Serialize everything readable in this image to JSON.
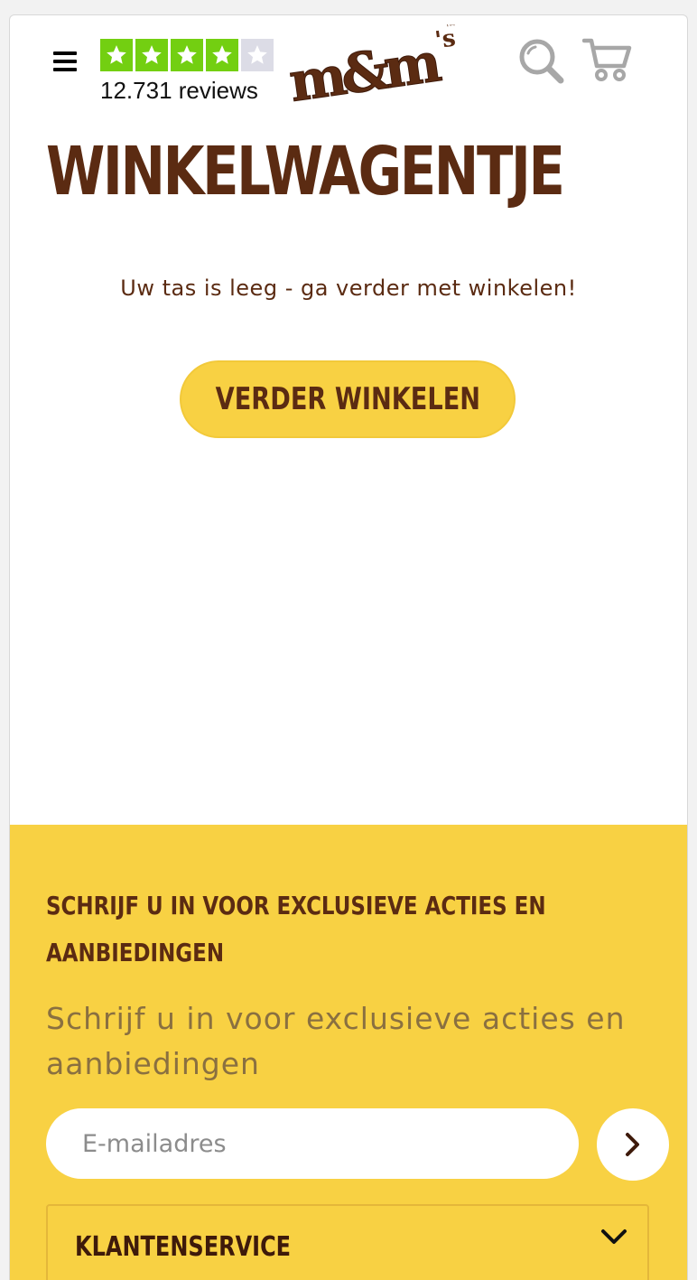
{
  "header": {
    "rating": {
      "stars_filled": 4,
      "stars_total": 5,
      "reviews_text": "12.731 reviews"
    },
    "logo_text": "m&m's"
  },
  "main": {
    "title": "WINKELWAGENTJE",
    "empty_message": "Uw tas is leeg - ga verder met winkelen!",
    "continue_button": "VERDER WINKELEN"
  },
  "footer": {
    "newsletter_heading_line1": "SCHRIJF U IN VOOR EXCLUSIEVE ACTIES EN",
    "newsletter_heading_line2": "AANBIEDINGEN",
    "newsletter_sub": "Schrijf u in voor exclusieve acties en aanbiedingen",
    "email_placeholder": "E-mailadres",
    "accordion_label": "KLANTENSERVICE"
  },
  "colors": {
    "brand_brown": "#5b2b12",
    "brand_yellow": "#f8d143",
    "star_green": "#73cf11",
    "star_empty": "#dcdce6"
  }
}
